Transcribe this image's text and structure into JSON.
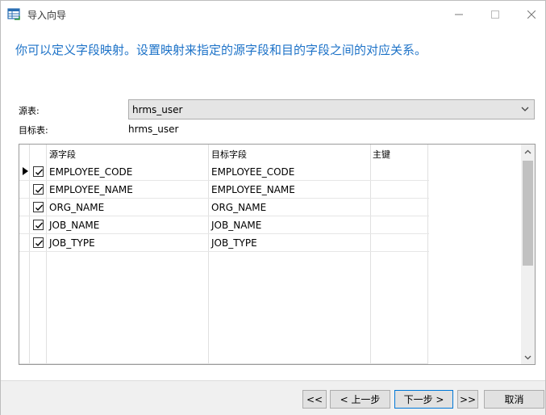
{
  "window": {
    "title": "导入向导"
  },
  "heading": "你可以定义字段映射。设置映射来指定的源字段和目的字段之间的对应关系。",
  "source": {
    "label": "源表:",
    "value": "hrms_user"
  },
  "target": {
    "label": "目标表:",
    "value": "hrms_user"
  },
  "grid": {
    "headers": {
      "source": "源字段",
      "target": "目标字段",
      "key": "主键"
    },
    "rows": [
      {
        "source": "EMPLOYEE_CODE",
        "target": "EMPLOYEE_CODE",
        "checked": true,
        "current": true
      },
      {
        "source": "EMPLOYEE_NAME",
        "target": "EMPLOYEE_NAME",
        "checked": true,
        "current": false
      },
      {
        "source": "ORG_NAME",
        "target": "ORG_NAME",
        "checked": true,
        "current": false
      },
      {
        "source": "JOB_NAME",
        "target": "JOB_NAME",
        "checked": true,
        "current": false
      },
      {
        "source": "JOB_TYPE",
        "target": "JOB_TYPE",
        "checked": true,
        "current": false
      }
    ]
  },
  "buttons": {
    "first": "<<",
    "prev": "< 上一步",
    "next": "下一步 >",
    "last": ">>",
    "cancel": "取消"
  },
  "icons": {
    "app": "table-import-icon",
    "minimize": "minimize-icon",
    "maximize": "maximize-icon",
    "close": "close-icon",
    "dropdown": "chevron-down-icon"
  },
  "colors": {
    "heading": "#1e73c8",
    "primary_border": "#0078d7"
  }
}
